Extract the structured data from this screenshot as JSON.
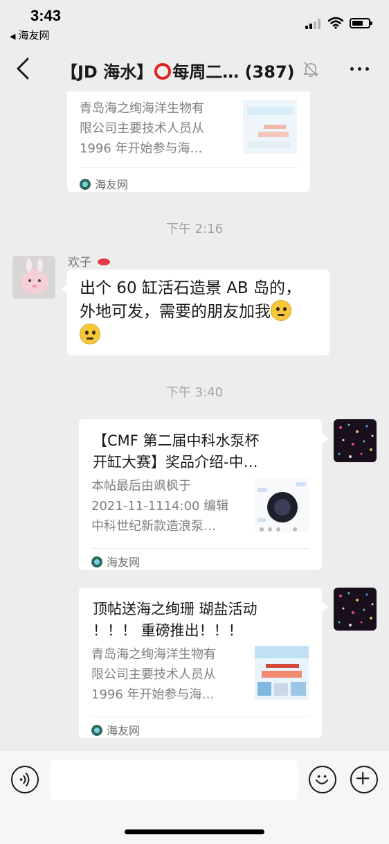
{
  "status_bar": {
    "time": "3:43",
    "back_app": "海友网"
  },
  "header": {
    "title_prefix": "【JD 海水】",
    "title_suffix": "每周二…",
    "member_count": "(387)"
  },
  "messages": {
    "card_top": {
      "desc_lines": [
        "青岛海之绚海洋生物有",
        "限公司主要技术人员从",
        "1996 年开始参与海…"
      ],
      "source": "海友网"
    },
    "timestamp_1": "下午 2:16",
    "text_message": {
      "sender": "欢子",
      "line1": "出个 60 缸活石造景 AB 岛的，",
      "line2": "外地可发，需要的朋友加我"
    },
    "timestamp_2": "下午 3:40",
    "card_1": {
      "title_lines": [
        "【CMF 第二届中科水泵杯",
        "开缸大赛】奖品介绍-中…"
      ],
      "desc_lines": [
        "本帖最后由飒枫于",
        "2021-11-1114:00 编辑",
        "中科世纪新款造浪泵…"
      ],
      "source": "海友网"
    },
    "card_2": {
      "title_lines": [
        "顶帖送海之绚珊 瑚盐活动",
        "！！！ 重磅推出！！！"
      ],
      "desc_lines": [
        "青岛海之绚海洋生物有",
        "限公司主要技术人员从",
        "1996 年开始参与海…"
      ],
      "source": "海友网"
    }
  },
  "colors": {
    "background": "#ededed",
    "bubble": "#ffffff",
    "ring_accent": "#e0221f"
  }
}
